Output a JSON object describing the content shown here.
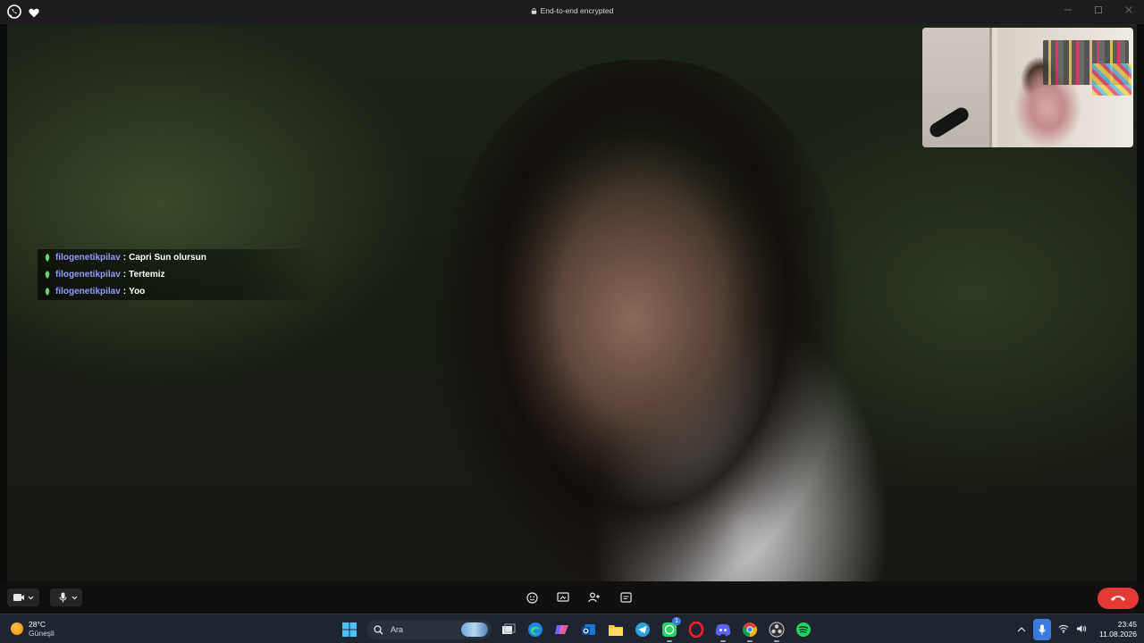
{
  "titlebar": {
    "app_icon": "whatsapp-icon",
    "secondary_icon": "heart-icon",
    "status_text": "End-to-end encrypted"
  },
  "chat_overlay": [
    {
      "user": "filogenetikpilav",
      "separator": ":",
      "message": "Capri Sun olursun"
    },
    {
      "user": "filogenetikpilav",
      "separator": ":",
      "message": "Tertemiz"
    },
    {
      "user": "filogenetikpilav",
      "separator": ":",
      "message": "Yoo"
    }
  ],
  "call_controls": {
    "video_icon": "video-camera-icon",
    "mic_icon": "microphone-icon",
    "emoji_icon": "emoji-icon",
    "screen_share_icon": "screen-share-icon",
    "add_person_icon": "add-person-icon",
    "captions_icon": "captions-icon",
    "end_call_icon": "phone-hangup-icon",
    "end_call_color": "#e53935"
  },
  "taskbar": {
    "weather": {
      "temp": "28°C",
      "desc": "Güneşli"
    },
    "search": {
      "label": "Ara"
    },
    "whatsapp_badge": "1",
    "clock": {
      "time": "23:45",
      "date": "11.08.2026"
    }
  },
  "colors": {
    "username": "#8f9cff",
    "whatsapp": "#25d366",
    "accent": "#3b7be0"
  }
}
